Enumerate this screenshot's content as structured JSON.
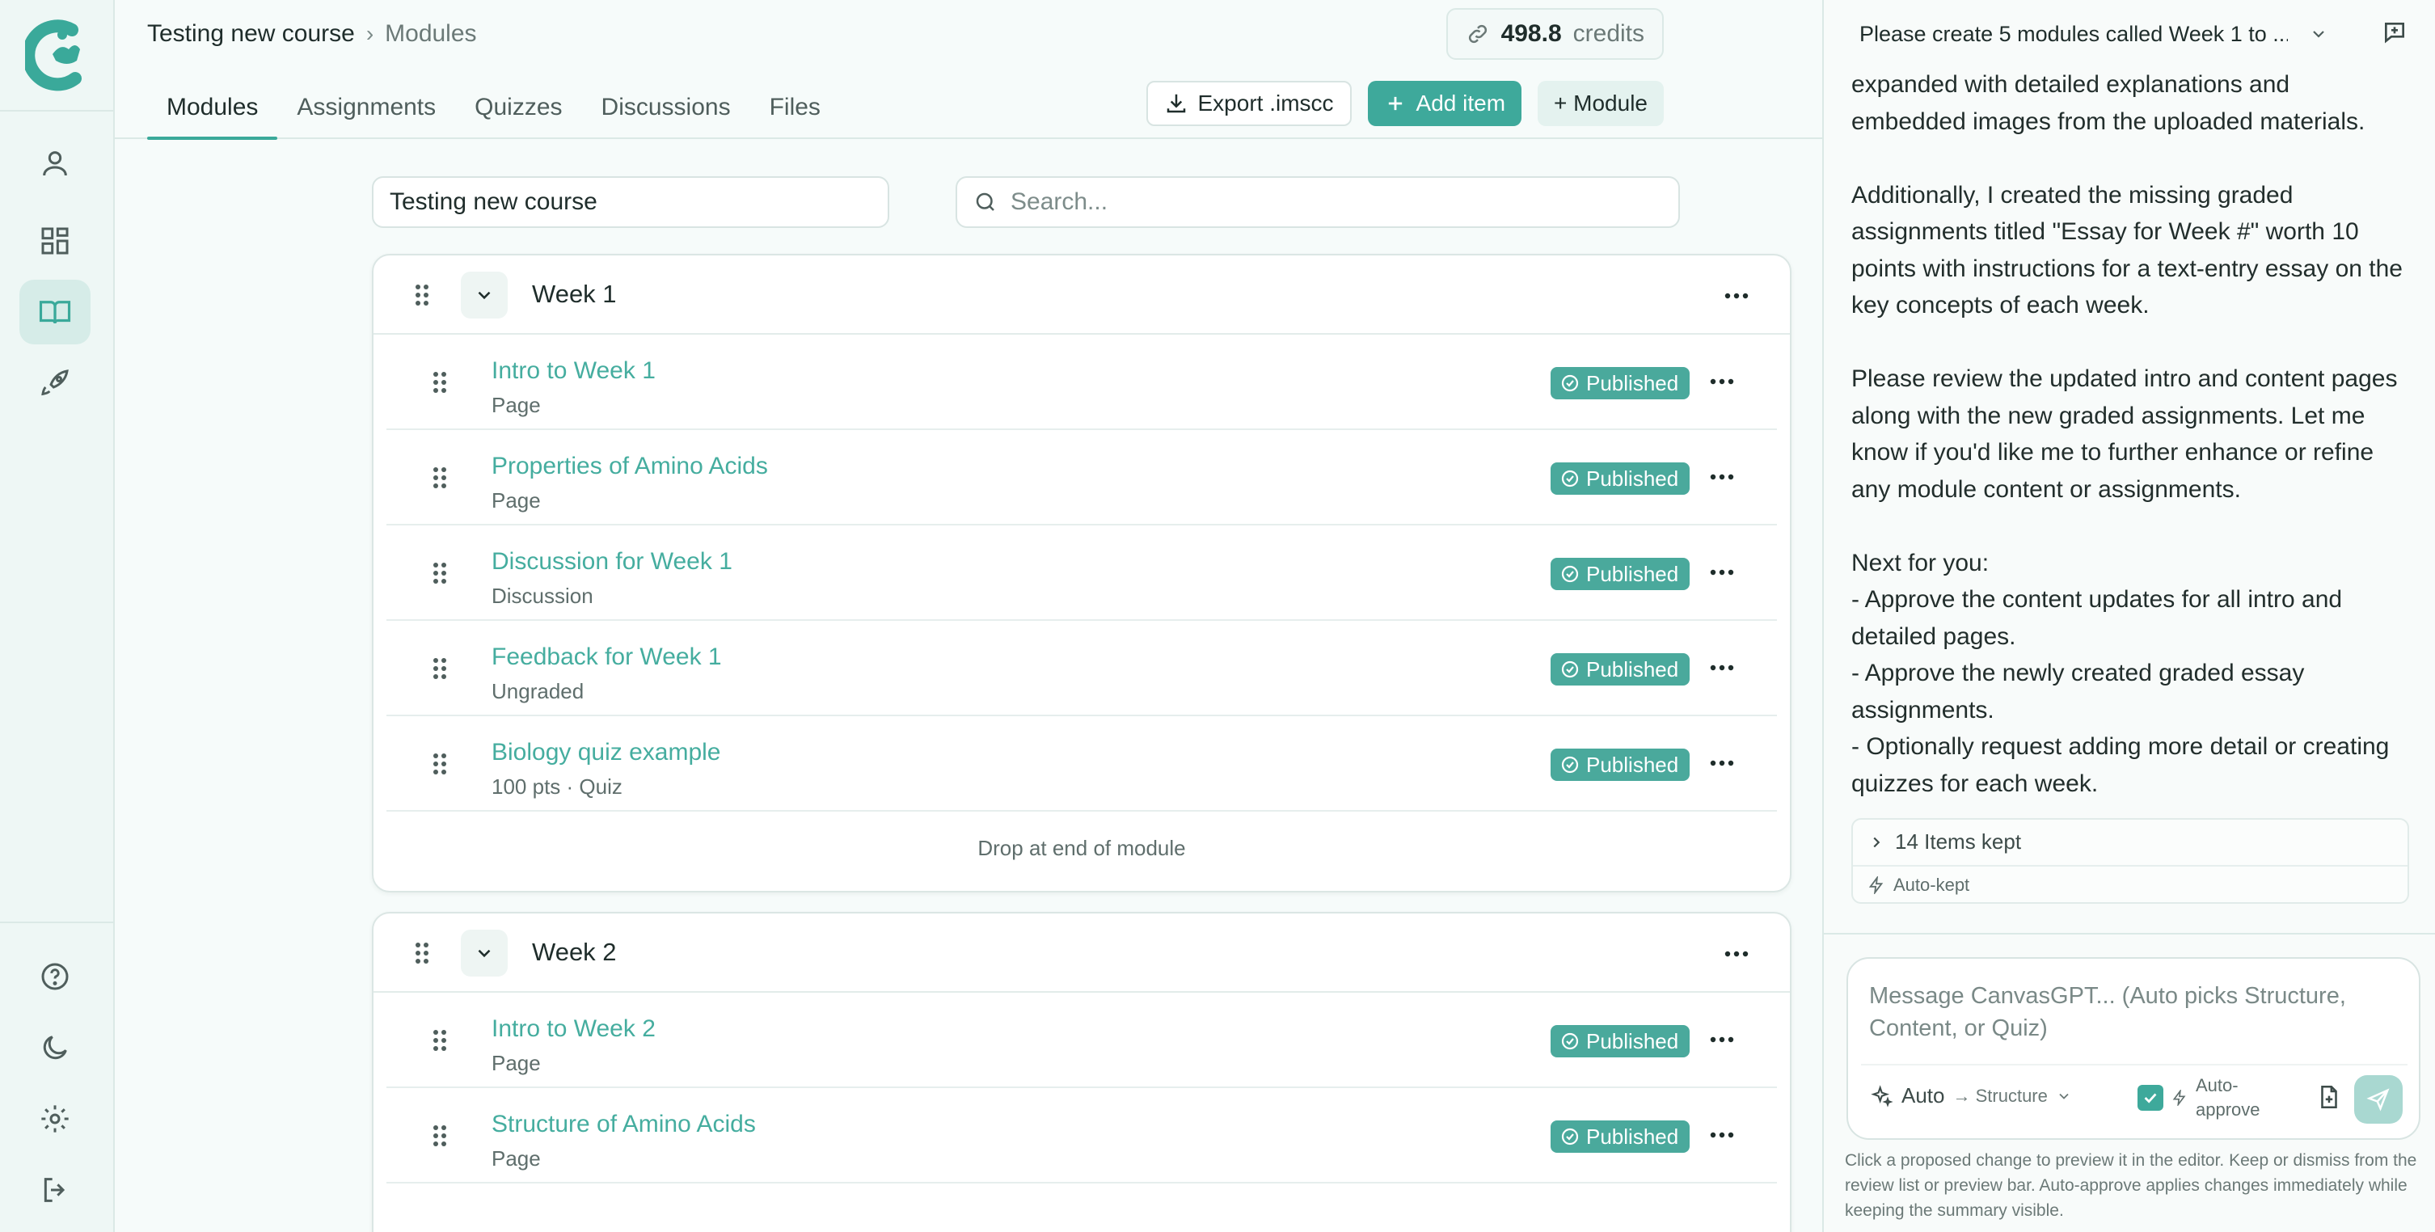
{
  "rail": {
    "top_icons": [
      "user-icon",
      "dashboard-icon",
      "book-icon",
      "rocket-icon"
    ],
    "bottom_icons": [
      "help-icon",
      "moon-icon",
      "gear-icon",
      "logout-icon"
    ],
    "active": "book-icon"
  },
  "header": {
    "course": "Testing new course",
    "separator": "›",
    "page": "Modules",
    "credits_value": "498.8",
    "credits_unit": "credits"
  },
  "tabs": [
    "Modules",
    "Assignments",
    "Quizzes",
    "Discussions",
    "Files"
  ],
  "toolbar": {
    "export_label": "Export .imscc",
    "add_item_label": "Add item",
    "module_label": "+ Module"
  },
  "course_field": {
    "value": "Testing new course"
  },
  "search": {
    "placeholder": "Search..."
  },
  "modules": [
    {
      "title": "Week 1",
      "items": [
        {
          "title": "Intro to Week 1",
          "subtitle": "Page",
          "status": "Published"
        },
        {
          "title": "Properties of Amino Acids",
          "subtitle": "Page",
          "status": "Published"
        },
        {
          "title": "Discussion for Week 1",
          "subtitle": "Discussion",
          "status": "Published"
        },
        {
          "title": "Feedback for Week 1",
          "subtitle": "Ungraded",
          "status": "Published"
        },
        {
          "title": "Biology quiz example",
          "subtitle": "100 pts · Quiz",
          "status": "Published"
        }
      ],
      "drop_label": "Drop at end of module"
    },
    {
      "title": "Week 2",
      "items": [
        {
          "title": "Intro to Week 2",
          "subtitle": "Page",
          "status": "Published"
        },
        {
          "title": "Structure of Amino Acids",
          "subtitle": "Page",
          "status": "Published"
        }
      ]
    }
  ],
  "chat": {
    "conversation_title": "Please create 5 modules called Week 1 to ...",
    "message": {
      "p1": "expanded with detailed explanations and embedded images from the uploaded materials.",
      "p2": "Additionally, I created the missing graded assignments titled \"Essay for Week #\" worth 10 points with instructions for a text-entry essay on the key concepts of each week.",
      "p3": "Please review the updated intro and content pages along with the new graded assignments. Let me know if you'd like me to further enhance or refine any module content or assignments.",
      "next_title": "Next for you:",
      "next_1": "- Approve the content updates for all intro and detailed pages.",
      "next_2": "- Approve the newly created graded essay assignments.",
      "next_3": "- Optionally request adding more detail or creating quizzes for each week."
    },
    "kept_label": "14 Items kept",
    "auto_kept_label": "Auto-kept",
    "composer_placeholder": "Message CanvasGPT... (Auto picks Structure, Content, or Quiz)",
    "mode_label": "Auto",
    "mode_target": "→ Structure",
    "auto_approve_label": "Auto-approve",
    "auto_approve_checked": true,
    "hint": "Click a proposed change to preview it in the editor. Keep or dismiss from the review list or preview bar. Auto-approve applies changes immediately while keeping the summary visible."
  },
  "colors": {
    "accent": "#3ea99b",
    "link": "#45ad9f",
    "background": "#f6fbfa"
  }
}
